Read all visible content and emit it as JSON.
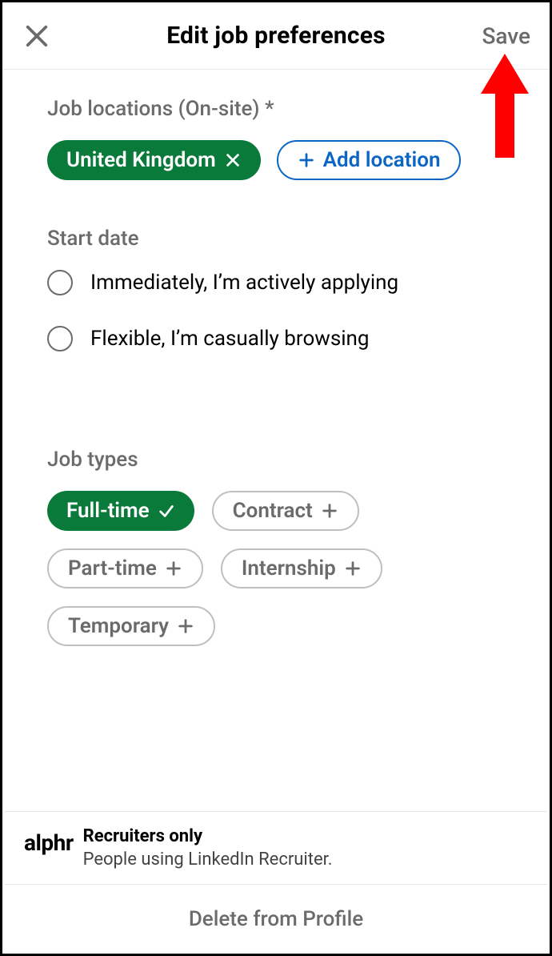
{
  "header": {
    "title": "Edit job preferences",
    "save_label": "Save"
  },
  "sections": {
    "locations": {
      "label": "Job locations (On-site) *",
      "chips": {
        "uk": "United Kingdom"
      },
      "add_label": "Add location"
    },
    "start_date": {
      "label": "Start date",
      "options": {
        "immediate": "Immediately, I’m actively applying",
        "flexible": "Flexible, I’m casually browsing"
      }
    },
    "job_types": {
      "label": "Job types",
      "chips": {
        "fulltime": "Full-time",
        "contract": "Contract",
        "parttime": "Part-time",
        "internship": "Internship",
        "temporary": "Temporary"
      }
    }
  },
  "visibility": {
    "brand": "alphr",
    "title": "Recruiters only",
    "subtitle": "People using LinkedIn Recruiter."
  },
  "footer": {
    "delete_label": "Delete from Profile"
  }
}
